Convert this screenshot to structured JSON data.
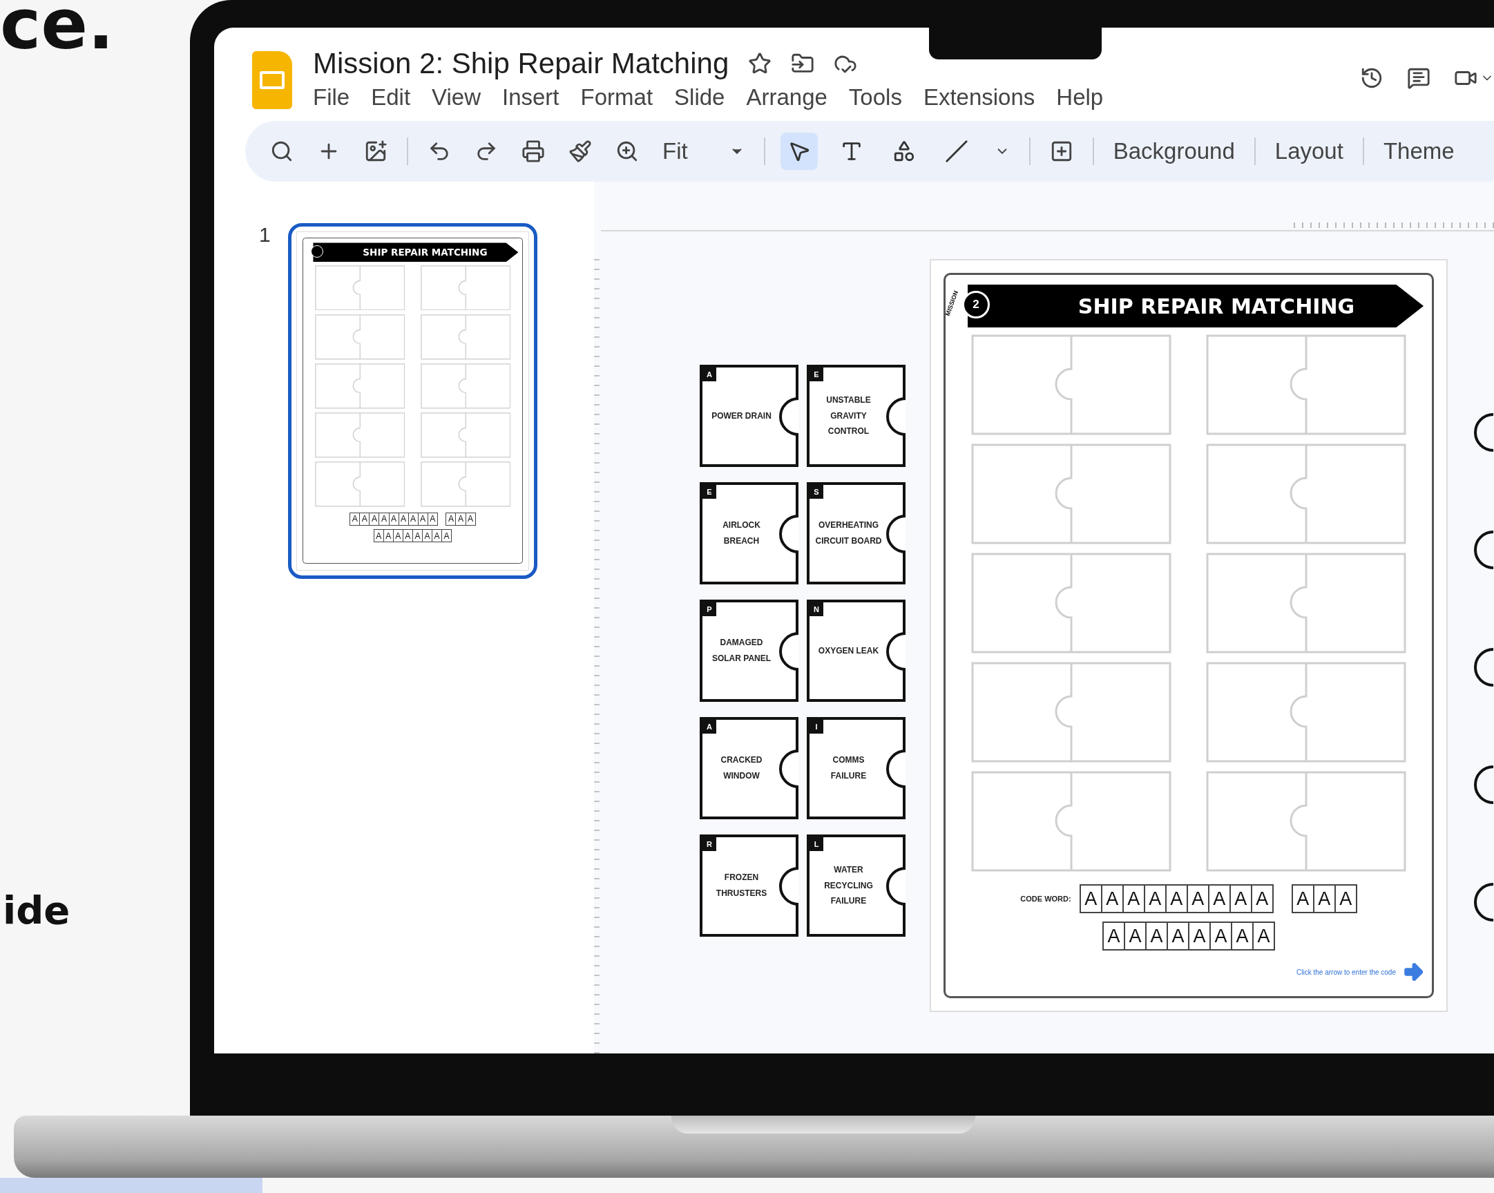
{
  "backdrop": {
    "heading_fragment": "ce.",
    "caption_fragment": "ide"
  },
  "app": {
    "title": "Mission 2: Ship Repair Matching",
    "menu": [
      "File",
      "Edit",
      "View",
      "Insert",
      "Format",
      "Slide",
      "Arrange",
      "Tools",
      "Extensions",
      "Help"
    ]
  },
  "toolbar": {
    "zoom_label": "Fit",
    "tools": [
      {
        "kind": "select",
        "selected": true
      },
      {
        "kind": "text",
        "selected": false
      },
      {
        "kind": "shape",
        "selected": false
      },
      {
        "kind": "line",
        "selected": false
      }
    ],
    "buttons": [
      "Background",
      "Layout",
      "Theme"
    ]
  },
  "filmstrip": [
    {
      "number": "1",
      "selected": true,
      "sheet": {
        "title": "SHIP REPAIR MATCHING",
        "code_rows": [
          [
            [
              "A",
              "A",
              "A",
              "A",
              "A",
              "A",
              "A",
              "A",
              "A"
            ],
            [
              "A",
              "A",
              "A"
            ]
          ],
          [
            [
              "A",
              "A",
              "A",
              "A",
              "A",
              "A",
              "A",
              "A"
            ]
          ]
        ]
      }
    }
  ],
  "pieces": [
    {
      "letter": "A",
      "text": "POWER DRAIN"
    },
    {
      "letter": "E",
      "text": "UNSTABLE GRAVITY CONTROL"
    },
    {
      "letter": "E",
      "text": "AIRLOCK BREACH"
    },
    {
      "letter": "S",
      "text": "OVERHEATING CIRCUIT BOARD"
    },
    {
      "letter": "P",
      "text": "DAMAGED SOLAR PANEL"
    },
    {
      "letter": "N",
      "text": "OXYGEN LEAK"
    },
    {
      "letter": "A",
      "text": "CRACKED WINDOW"
    },
    {
      "letter": "I",
      "text": "COMMS FAILURE"
    },
    {
      "letter": "R",
      "text": "FROZEN THRUSTERS"
    },
    {
      "letter": "L",
      "text": "WATER RECYCLING FAILURE"
    }
  ],
  "slide": {
    "badge_label": "MISSION",
    "badge_number": "2",
    "title": "SHIP REPAIR MATCHING",
    "code_label": "CODE WORD:",
    "code_rows": [
      [
        [
          "A",
          "A",
          "A",
          "A",
          "A",
          "A",
          "A",
          "A",
          "A"
        ],
        [
          "A",
          "A",
          "A"
        ]
      ],
      [
        [
          "A",
          "A",
          "A",
          "A",
          "A",
          "A",
          "A",
          "A"
        ]
      ]
    ],
    "hint": "Click the arrow to enter the code"
  }
}
